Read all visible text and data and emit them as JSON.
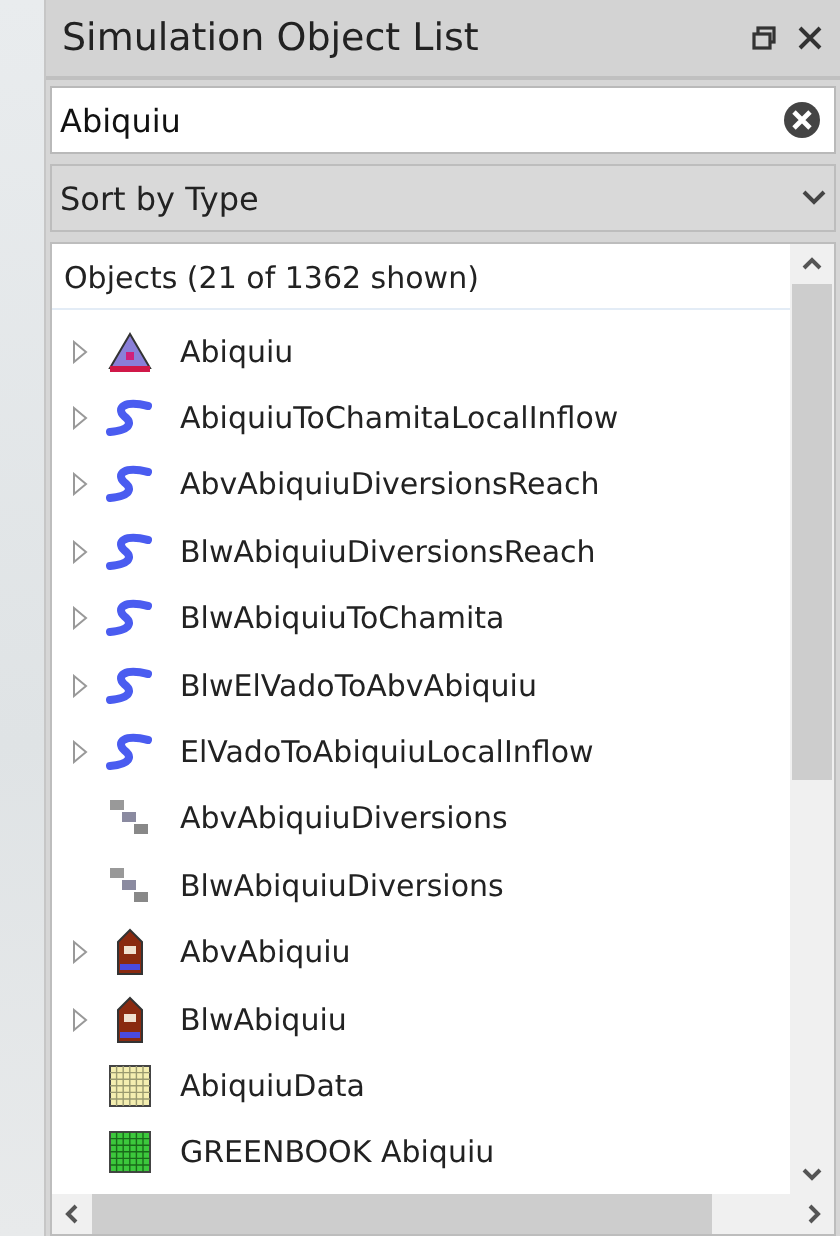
{
  "panel": {
    "title": "Simulation Object List"
  },
  "search": {
    "value": "Abiquiu"
  },
  "sort": {
    "value": "Sort by Type"
  },
  "list": {
    "header": "Objects (21 of 1362 shown)",
    "items": [
      {
        "kind": "reservoir",
        "label": "Abiquiu",
        "expandable": true
      },
      {
        "kind": "reach",
        "label": "AbiquiuToChamitaLocalInflow",
        "expandable": true
      },
      {
        "kind": "reach",
        "label": "AbvAbiquiuDiversionsReach",
        "expandable": true
      },
      {
        "kind": "reach",
        "label": "BlwAbiquiuDiversionsReach",
        "expandable": true
      },
      {
        "kind": "reach",
        "label": "BlwAbiquiuToChamita",
        "expandable": true
      },
      {
        "kind": "reach",
        "label": "BlwElVadoToAbvAbiquiu",
        "expandable": true
      },
      {
        "kind": "reach",
        "label": "ElVadoToAbiquiuLocalInflow",
        "expandable": true
      },
      {
        "kind": "diversion",
        "label": "AbvAbiquiuDiversions",
        "expandable": false
      },
      {
        "kind": "diversion",
        "label": "BlwAbiquiuDiversions",
        "expandable": false
      },
      {
        "kind": "gage",
        "label": "AbvAbiquiu",
        "expandable": true
      },
      {
        "kind": "gage",
        "label": "BlwAbiquiu",
        "expandable": true
      },
      {
        "kind": "data",
        "label": "AbiquiuData",
        "expandable": false
      },
      {
        "kind": "greenbook",
        "label": "GREENBOOK Abiquiu",
        "expandable": false
      }
    ]
  }
}
